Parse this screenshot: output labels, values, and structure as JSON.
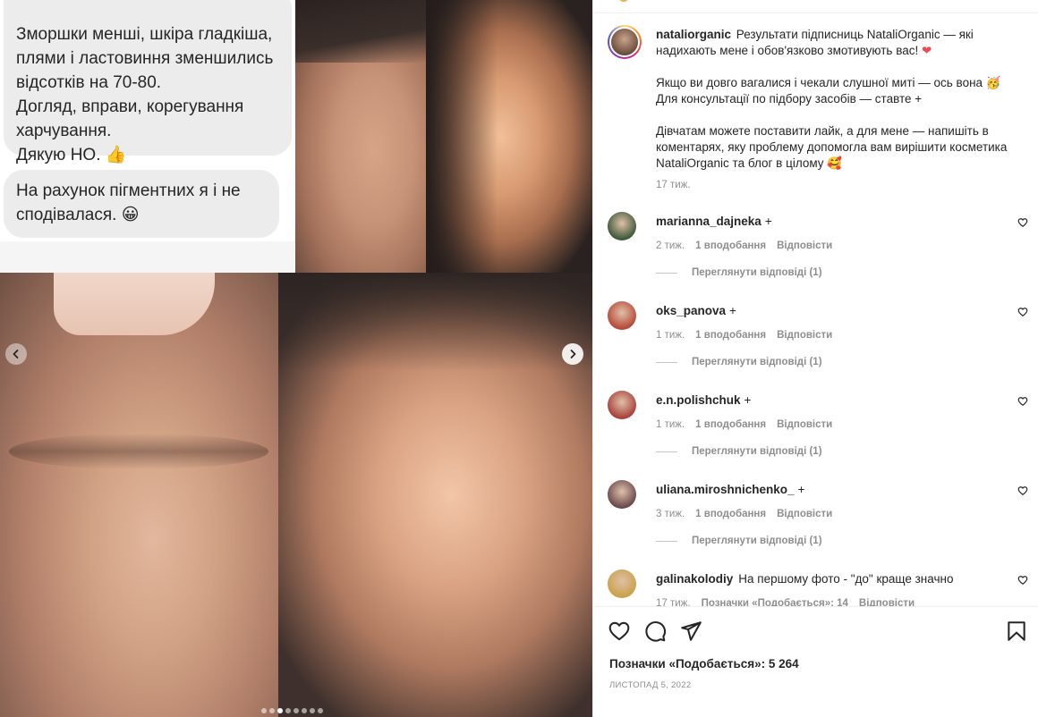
{
  "media": {
    "message_1": "Зморшки менші, шкіра гладкіша, плями і ластовиння зменшились відсотків на 70-80.\nДогляд, вправи, корегування харчування.\nДякую НО. 👍",
    "message_2": "На рахунок пігментних я і не сподівалася. 😀",
    "carousel": {
      "total": 8,
      "active_index": 2
    }
  },
  "post": {
    "author": "nataliorganic",
    "caption_line_1": "Результати підписниць NataliOrganic — які надихають мене і обов'язково змотивують вас! ",
    "caption_line_2": "Якщо ви довго вагалися і чекали слушної миті — ось вона 🥳\nДля консультації по підбору засобів — ставте +",
    "caption_line_3": "Дівчатам можете поставити лайк, а для мене — напишіть в коментарях, яку проблему допомогла вам вирішити косметика NataliOrganic та блог в цілому 🥰",
    "caption_heart": "❤",
    "caption_time": "17 тиж."
  },
  "comments": [
    {
      "user": "marianna_dajneka",
      "plus": "+",
      "text": "",
      "time": "2 тиж.",
      "likes": "1 вподобання",
      "reply": "Відповісти",
      "view_replies": "Переглянути відповіді (1)",
      "avatar_color": "#3f5a3a"
    },
    {
      "user": "oks_panova",
      "plus": "+",
      "text": "",
      "time": "1 тиж.",
      "likes": "1 вподобання",
      "reply": "Відповісти",
      "view_replies": "Переглянути відповіді (1)",
      "avatar_color": "#b74a3a"
    },
    {
      "user": "e.n.polishchuk",
      "plus": "+",
      "text": "",
      "time": "1 тиж.",
      "likes": "1 вподобання",
      "reply": "Відповісти",
      "view_replies": "Переглянути відповіді (1)",
      "avatar_color": "#a9423c"
    },
    {
      "user": "uliana.miroshnichenko_",
      "plus": "+",
      "text": "",
      "time": "3 тиж.",
      "likes": "1 вподобання",
      "reply": "Відповісти",
      "view_replies": "Переглянути відповіді (1)",
      "avatar_color": "#6b4a4e"
    },
    {
      "user": "galinakolodiy",
      "plus": "",
      "text": "На першому фото - \"до\" краще значно",
      "time": "17 тиж.",
      "likes": "Позначки «Подобається»: 14",
      "reply": "Відповісти",
      "view_replies": "",
      "avatar_color": "#c9a24a"
    }
  ],
  "footer": {
    "likes": "Позначки «Подобається»: 5 264",
    "date": "ЛИСТОПАД 5, 2022"
  },
  "icons": {
    "like": "heart-icon",
    "comment": "comment-icon",
    "share": "send-icon",
    "save": "bookmark-icon",
    "prev": "chevron-left-icon",
    "next": "chevron-right-icon"
  }
}
